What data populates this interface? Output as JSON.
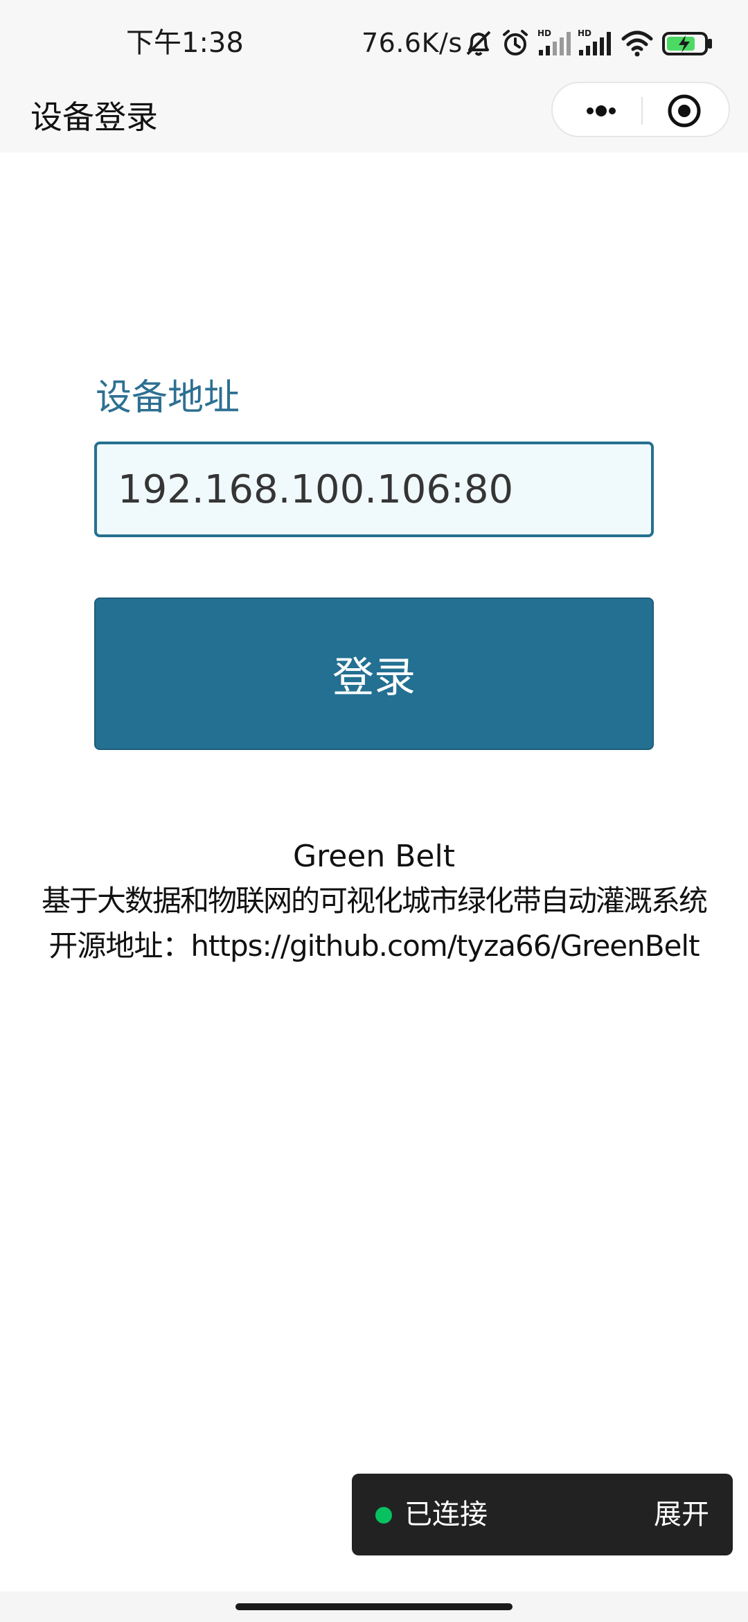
{
  "status_bar": {
    "time": "下午1:38",
    "network_speed": "76.6K/s",
    "icons": [
      "mute-bell-icon",
      "alarm-icon",
      "hd-signal-icon",
      "hd-signal-icon",
      "wifi-icon",
      "battery-charging-icon"
    ]
  },
  "nav": {
    "title": "设备登录",
    "more_icon": "more-dots-icon",
    "close_icon": "target-circle-icon"
  },
  "form": {
    "address_label": "设备地址",
    "address_value": "192.168.100.106:80",
    "login_label": "登录"
  },
  "info": {
    "title": "Green Belt",
    "description": "基于大数据和物联网的可视化城市绿化带自动灌溉系统",
    "repo": "开源地址：https://github.com/tyza66/GreenBelt"
  },
  "connection": {
    "status": "已连接",
    "expand_label": "展开",
    "status_color": "#07c160"
  },
  "colors": {
    "accent": "#237092",
    "label": "#2e7092",
    "input_background": "#f0f9fc",
    "toast_background": "#222222"
  }
}
